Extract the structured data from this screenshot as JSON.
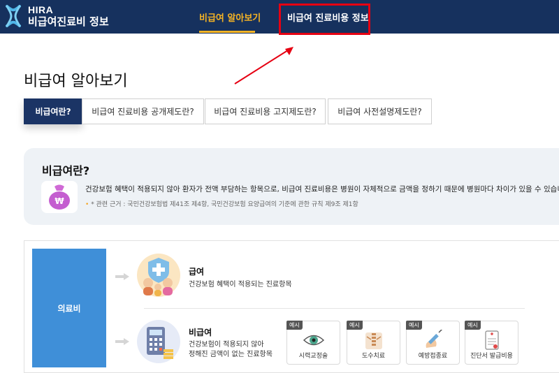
{
  "header": {
    "logo_top": "HIRA",
    "logo_bottom": "비급여진료비 정보",
    "nav": [
      {
        "label": "비급여 알아보기",
        "active": true
      },
      {
        "label": "비급여 진료비용 정보",
        "active": false
      }
    ],
    "active_color": "#f5b324",
    "highlight_color": "#e60012"
  },
  "page_title": "비급여 알아보기",
  "tabs": [
    {
      "label": "비급여란?",
      "active": true
    },
    {
      "label": "비급여 진료비용 공개제도란?",
      "active": false
    },
    {
      "label": "비급여 진료비용 고지제도란?",
      "active": false
    },
    {
      "label": "비급여 사전설명제도란?",
      "active": false
    }
  ],
  "info": {
    "title": "비급여란?",
    "icon": "money-bag-icon",
    "description": "건강보험 혜택이 적용되지 않아 환자가 전액 부담하는 항목으로, 비급여 진료비용은 병원이 자체적으로 금액을 정하기 때문에 병원마다 차이가 있을 수 있습니다.",
    "note": "* 관련 근거 : 국민건강보험법 제41조 제4항, 국민건강보험 요양급여의 기준에 관한 규칙 제9조 제1항"
  },
  "diagram": {
    "main_label": "의료비",
    "covered": {
      "title": "급여",
      "description": "건강보험 혜택이 적용되는 진료항목",
      "icon": "family-shield-icon"
    },
    "uncovered": {
      "title": "비급여",
      "description_line1": "건강보험이 적용되지 않아",
      "description_line2": "정해진 금액이 없는 진료항목",
      "icon": "calculator-money-icon"
    },
    "example_tag": "예시",
    "examples": [
      {
        "label": "시력교정술",
        "icon": "eye-icon"
      },
      {
        "label": "도수치료",
        "icon": "spine-icon"
      },
      {
        "label": "예방접종료",
        "icon": "syringe-icon"
      },
      {
        "label": "진단서 발급비용",
        "icon": "document-icon"
      }
    ],
    "main_color": "#3f8fd8"
  }
}
